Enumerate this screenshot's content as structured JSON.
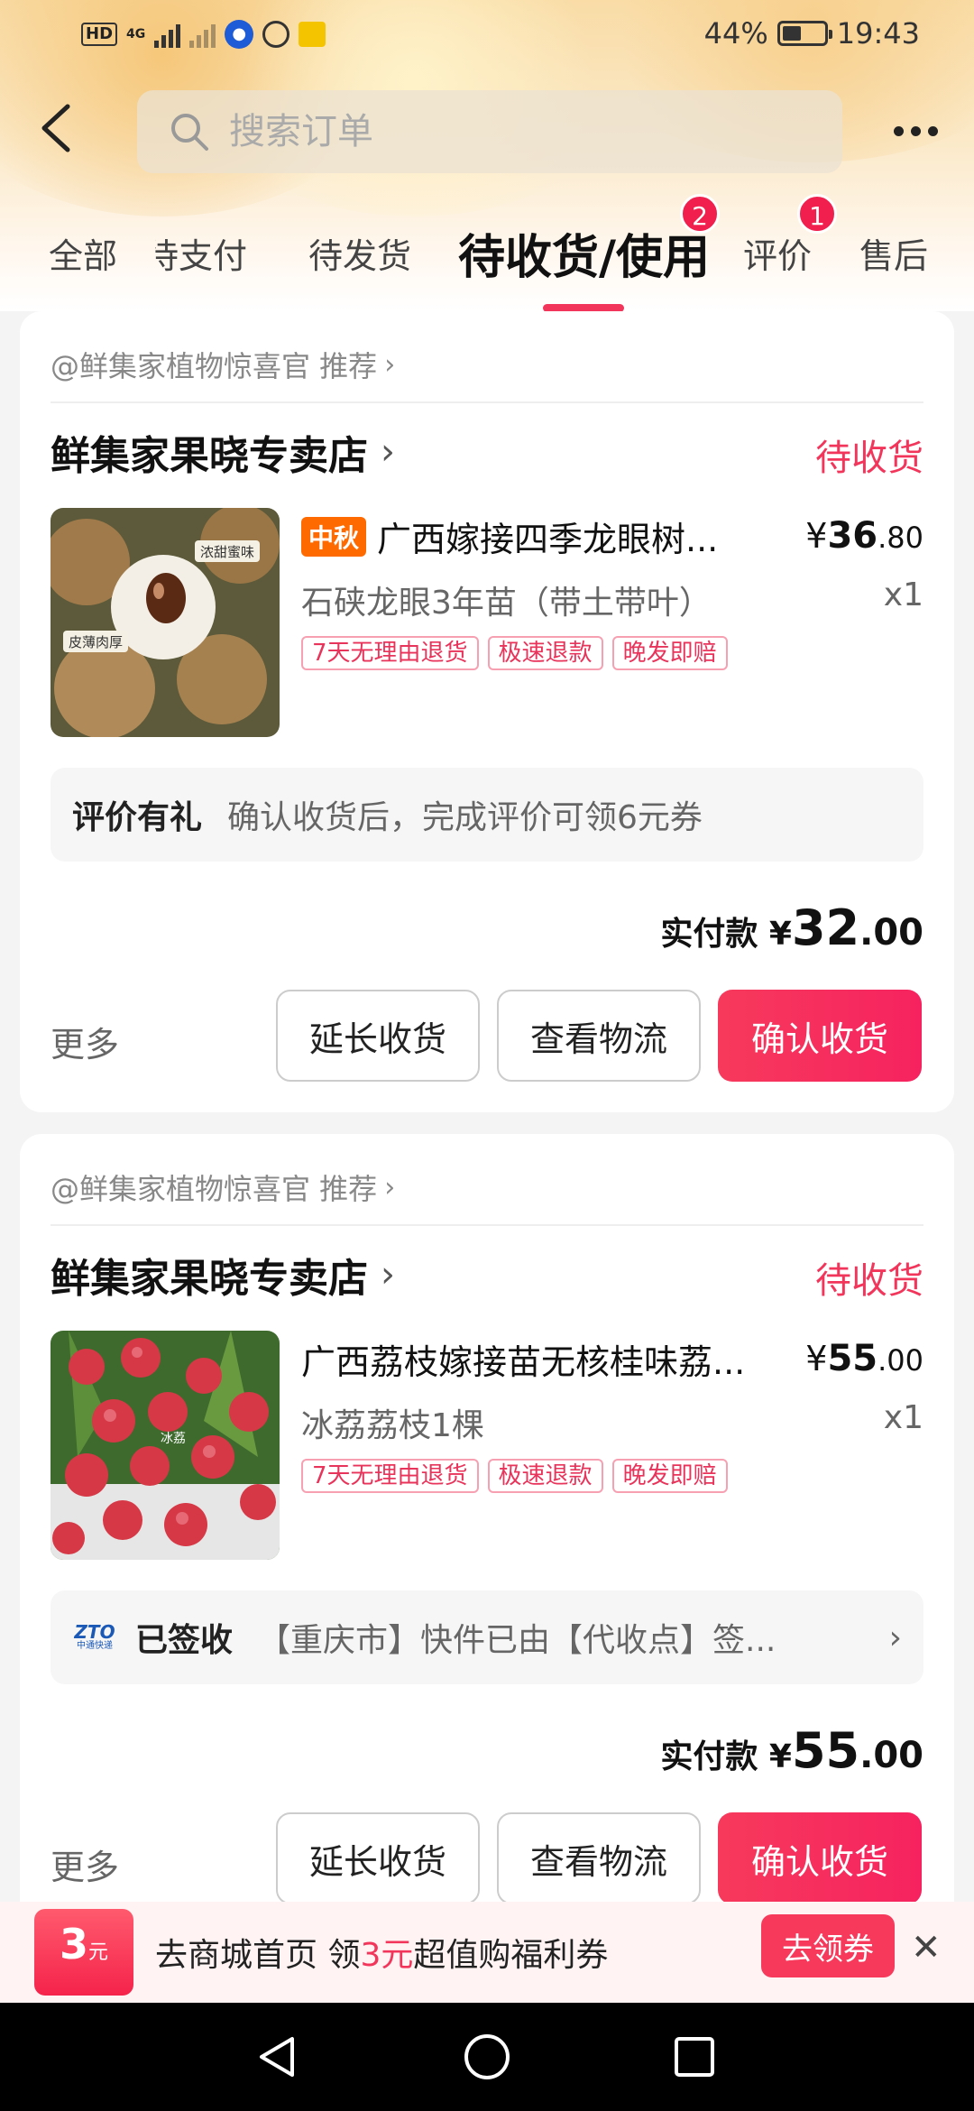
{
  "status_bar": {
    "hd": "HD",
    "net": "4G",
    "battery": "44%",
    "time": "19:43"
  },
  "search": {
    "placeholder": "搜索订单"
  },
  "tabs": [
    {
      "label": "全部"
    },
    {
      "label": "待支付"
    },
    {
      "label": "待发货"
    },
    {
      "label": "待收货/使用",
      "badge": "2"
    },
    {
      "label": "评价",
      "badge": "1"
    },
    {
      "label": "售后"
    }
  ],
  "orders": [
    {
      "recommend": "@鲜集家植物惊喜官 推荐",
      "shop": "鲜集家果晓专卖店",
      "status": "待收货",
      "promo_tag": "中秋",
      "title": "广西嫁接四季龙眼树...",
      "price_symbol": "¥",
      "price_int": "36",
      "price_dec": ".80",
      "spec": "石硖龙眼3年苗（带土带叶）",
      "qty": "x1",
      "tags": [
        "7天无理由退货",
        "极速退款",
        "晚发即赔"
      ],
      "info_key": "评价有礼",
      "info_val": "确认收货后，完成评价可领6元券",
      "paid_label": "实付款 ¥",
      "paid_int": "32",
      "paid_dec": ".00",
      "more": "更多",
      "btn_extend": "延长收货",
      "btn_logistics": "查看物流",
      "btn_confirm": "确认收货",
      "image_labels": [
        "浓甜蜜味",
        "皮薄肉厚"
      ]
    },
    {
      "recommend": "@鲜集家植物惊喜官 推荐",
      "shop": "鲜集家果晓专卖店",
      "status": "待收货",
      "title": "广西荔枝嫁接苗无核桂味荔...",
      "price_symbol": "¥",
      "price_int": "55",
      "price_dec": ".00",
      "spec": "冰荔荔枝1棵",
      "qty": "x1",
      "tags": [
        "7天无理由退货",
        "极速退款",
        "晚发即赔"
      ],
      "logistics_logo": "ZTO",
      "logistics_logo_sub": "中通快递",
      "info_key": "已签收",
      "info_val": "【重庆市】快件已由【代收点】签...",
      "paid_label": "实付款 ¥",
      "paid_int": "55",
      "paid_dec": ".00",
      "more": "更多",
      "btn_extend": "延长收货",
      "btn_logistics": "查看物流",
      "btn_confirm": "确认收货",
      "image_labels": [
        "冰荔"
      ]
    }
  ],
  "banner": {
    "coupon_num": "3",
    "coupon_unit": "元",
    "text_a": "去商城首页 领",
    "text_hl": "3元",
    "text_b": "超值购福利券",
    "cta": "去领券",
    "close": "✕"
  },
  "colors": {
    "accent": "#f2365b",
    "header_bg": "#f9dca6"
  }
}
